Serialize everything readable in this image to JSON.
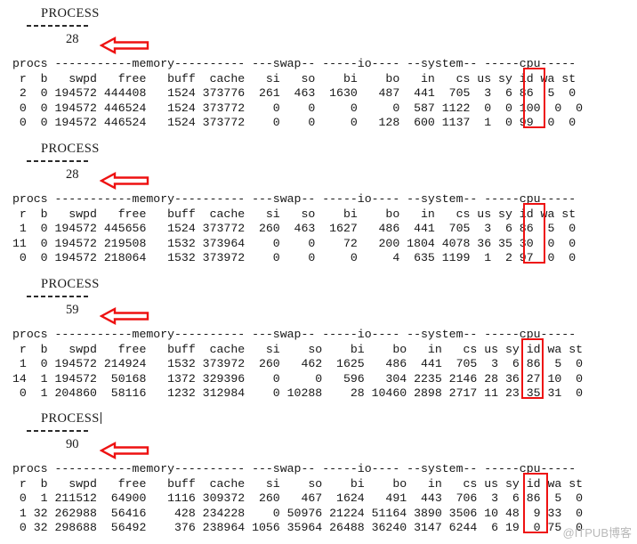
{
  "terminal": {
    "process_label": "PROCESS",
    "watermark": "@ITPUB博客",
    "arrow_color": "#ee1111",
    "highlight_color": "#ee1111",
    "text_color": "#171717",
    "background": "#ffffff",
    "header_group_line": "procs -----------memory---------- ---swap-- -----io---- --system-- -----cpu-----",
    "header_col_line": " r  b   swpd   free   buff  cache   si   so    bi    bo   in   cs us sy id wa st"
  },
  "sections": [
    {
      "label": "PROCESS",
      "count": "28",
      "has_caret": false,
      "group_header": "procs -----------memory---------- ---swap-- -----io---- --system-- -----cpu-----",
      "column_header": " r  b   swpd   free   buff  cache   si   so    bi    bo   in   cs us sy id wa st",
      "rows": [
        " 2  0 194572 444408   1524 373776  261  463  1630   487  441  705  3  6 86  5  0",
        " 0  0 194572 446524   1524 373772    0    0     0     0  587 1122  0  0 100  0  0",
        " 0  0 194572 446524   1524 373772    0    0     0   128  600 1137  1  0 99  0  0"
      ],
      "rows_fields": [
        {
          "r": "2",
          "b": "0",
          "swpd": "194572",
          "free": "444408",
          "buff": "1524",
          "cache": "373776",
          "si": "261",
          "so": "463",
          "bi": "1630",
          "bo": "487",
          "in": "441",
          "cs": "705",
          "us": "3",
          "sy": "6",
          "id": "86",
          "wa": "5",
          "st": "0"
        },
        {
          "r": "0",
          "b": "0",
          "swpd": "194572",
          "free": "446524",
          "buff": "1524",
          "cache": "373772",
          "si": "0",
          "so": "0",
          "bi": "0",
          "bo": "0",
          "in": "587",
          "cs": "1122",
          "us": "0",
          "sy": "0",
          "id": "100",
          "wa": "0",
          "st": "0"
        },
        {
          "r": "0",
          "b": "0",
          "swpd": "194572",
          "free": "446524",
          "buff": "1524",
          "cache": "373772",
          "si": "0",
          "so": "0",
          "bi": "0",
          "bo": "128",
          "in": "600",
          "cs": "1137",
          "us": "1",
          "sy": "0",
          "id": "99",
          "wa": "0",
          "st": "0"
        }
      ]
    },
    {
      "label": "PROCESS",
      "count": "28",
      "has_caret": false,
      "group_header": "procs -----------memory---------- ---swap-- -----io---- --system-- -----cpu-----",
      "column_header": " r  b   swpd   free   buff  cache   si   so    bi    bo   in   cs us sy id wa st",
      "rows": [
        " 1  0 194572 445656   1524 373772  260  463  1627   486  441  705  3  6 86  5  0",
        "11  0 194572 219508   1532 373964    0    0    72   200 1804 4078 36 35 30  0  0",
        " 0  0 194572 218064   1532 373972    0    0     0     4  635 1199  1  2 97  0  0"
      ],
      "rows_fields": [
        {
          "r": "1",
          "b": "0",
          "swpd": "194572",
          "free": "445656",
          "buff": "1524",
          "cache": "373772",
          "si": "260",
          "so": "463",
          "bi": "1627",
          "bo": "486",
          "in": "441",
          "cs": "705",
          "us": "3",
          "sy": "6",
          "id": "86",
          "wa": "5",
          "st": "0"
        },
        {
          "r": "11",
          "b": "0",
          "swpd": "194572",
          "free": "219508",
          "buff": "1532",
          "cache": "373964",
          "si": "0",
          "so": "0",
          "bi": "72",
          "bo": "200",
          "in": "1804",
          "cs": "4078",
          "us": "36",
          "sy": "35",
          "id": "30",
          "wa": "0",
          "st": "0"
        },
        {
          "r": "0",
          "b": "0",
          "swpd": "194572",
          "free": "218064",
          "buff": "1532",
          "cache": "373972",
          "si": "0",
          "so": "0",
          "bi": "0",
          "bo": "4",
          "in": "635",
          "cs": "1199",
          "us": "1",
          "sy": "2",
          "id": "97",
          "wa": "0",
          "st": "0"
        }
      ]
    },
    {
      "label": "PROCESS",
      "count": "59",
      "has_caret": false,
      "group_header": "procs -----------memory---------- ---swap-- -----io---- --system-- -----cpu-----",
      "column_header": " r  b   swpd   free   buff  cache   si    so    bi    bo   in   cs us sy id wa st",
      "rows": [
        " 1  0 194572 214924   1532 373972  260   462  1625   486  441  705  3  6 86  5  0",
        "14  1 194572  50168   1372 329396    0     0   596   304 2235 2146 28 36 27 10  0",
        " 0  1 204860  58116   1232 312984    0 10288    28 10460 2898 2717 11 23 35 31  0"
      ],
      "rows_fields": [
        {
          "r": "1",
          "b": "0",
          "swpd": "194572",
          "free": "214924",
          "buff": "1532",
          "cache": "373972",
          "si": "260",
          "so": "462",
          "bi": "1625",
          "bo": "486",
          "in": "441",
          "cs": "705",
          "us": "3",
          "sy": "6",
          "id": "86",
          "wa": "5",
          "st": "0"
        },
        {
          "r": "14",
          "b": "1",
          "swpd": "194572",
          "free": "50168",
          "buff": "1372",
          "cache": "329396",
          "si": "0",
          "so": "0",
          "bi": "596",
          "bo": "304",
          "in": "2235",
          "cs": "2146",
          "us": "28",
          "sy": "36",
          "id": "27",
          "wa": "10",
          "st": "0"
        },
        {
          "r": "0",
          "b": "1",
          "swpd": "204860",
          "free": "58116",
          "buff": "1232",
          "cache": "312984",
          "si": "0",
          "so": "10288",
          "bi": "28",
          "bo": "10460",
          "in": "2898",
          "cs": "2717",
          "us": "11",
          "sy": "23",
          "id": "35",
          "wa": "31",
          "st": "0"
        }
      ]
    },
    {
      "label": "PROCESS",
      "count": "90",
      "has_caret": true,
      "group_header": "procs -----------memory---------- ---swap-- -----io---- --system-- -----cpu-----",
      "column_header": " r  b   swpd   free   buff  cache   si    so    bi    bo   in   cs us sy id wa st",
      "rows": [
        " 0  1 211512  64900   1116 309372  260   467  1624   491  443  706  3  6 86  5  0",
        " 1 32 262988  56416    428 234228    0 50976 21224 51164 3890 3506 10 48  9 33  0",
        " 0 32 298688  56492    376 238964 1056 35964 26488 36240 3147 6244  6 19  0 75  0"
      ],
      "rows_fields": [
        {
          "r": "0",
          "b": "1",
          "swpd": "211512",
          "free": "64900",
          "buff": "1116",
          "cache": "309372",
          "si": "260",
          "so": "467",
          "bi": "1624",
          "bo": "491",
          "in": "443",
          "cs": "706",
          "us": "3",
          "sy": "6",
          "id": "86",
          "wa": "5",
          "st": "0"
        },
        {
          "r": "1",
          "b": "32",
          "swpd": "262988",
          "free": "56416",
          "buff": "428",
          "cache": "234228",
          "si": "0",
          "so": "50976",
          "bi": "21224",
          "bo": "51164",
          "in": "3890",
          "cs": "3506",
          "us": "10",
          "sy": "48",
          "id": "9",
          "wa": "33",
          "st": "0"
        },
        {
          "r": "0",
          "b": "32",
          "swpd": "298688",
          "free": "56492",
          "buff": "376",
          "cache": "238964",
          "si": "1056",
          "so": "35964",
          "bi": "26488",
          "bo": "36240",
          "in": "3147",
          "cs": "6244",
          "us": "6",
          "sy": "19",
          "id": "0",
          "wa": "75",
          "st": "0"
        }
      ]
    }
  ]
}
